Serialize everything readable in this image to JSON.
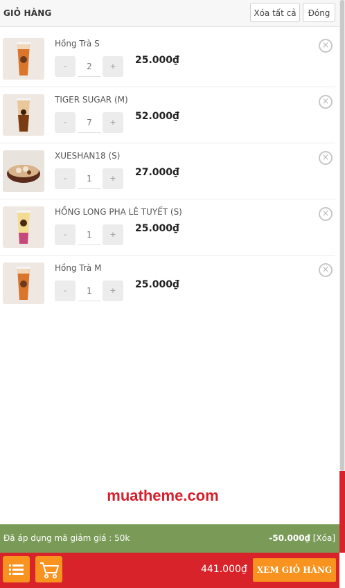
{
  "header": {
    "title": "GIỎ HÀNG",
    "clear_all_label": "Xóa tất cả",
    "close_label": "Đóng"
  },
  "cart_items": [
    {
      "name": "Hồng Trà S",
      "quantity": "2",
      "price": "25.000₫",
      "image": "milk-tea-cup"
    },
    {
      "name": "TIGER SUGAR (M)",
      "quantity": "7",
      "price": "52.000₫",
      "image": "brown-sugar-cup"
    },
    {
      "name": "XUESHAN18 (S)",
      "quantity": "1",
      "price": "27.000₫",
      "image": "dessert-bowl"
    },
    {
      "name": "HỒNG LONG PHA LÊ TUYẾT (S)",
      "quantity": "1",
      "price": "25.000₫",
      "image": "layered-pink-cup"
    },
    {
      "name": "Hồng Trà M",
      "quantity": "1",
      "price": "25.000₫",
      "image": "milk-tea-cup"
    }
  ],
  "qty_controls": {
    "minus": "-",
    "plus": "+"
  },
  "remove_icon": "×",
  "watermark": "muatheme.com",
  "promo": {
    "message": "Đã áp dụng mã giảm giá : 50k",
    "amount": "-50.000₫",
    "remove_label": "[Xóa]"
  },
  "footer": {
    "total": "441.000₫",
    "view_cart_label": "XEM GIỎ HÀNG"
  },
  "colors": {
    "footer_bg": "#d8232a",
    "accent_orange": "#f7931e",
    "promo_bg": "#7a9b58",
    "watermark": "#d71f2b"
  }
}
